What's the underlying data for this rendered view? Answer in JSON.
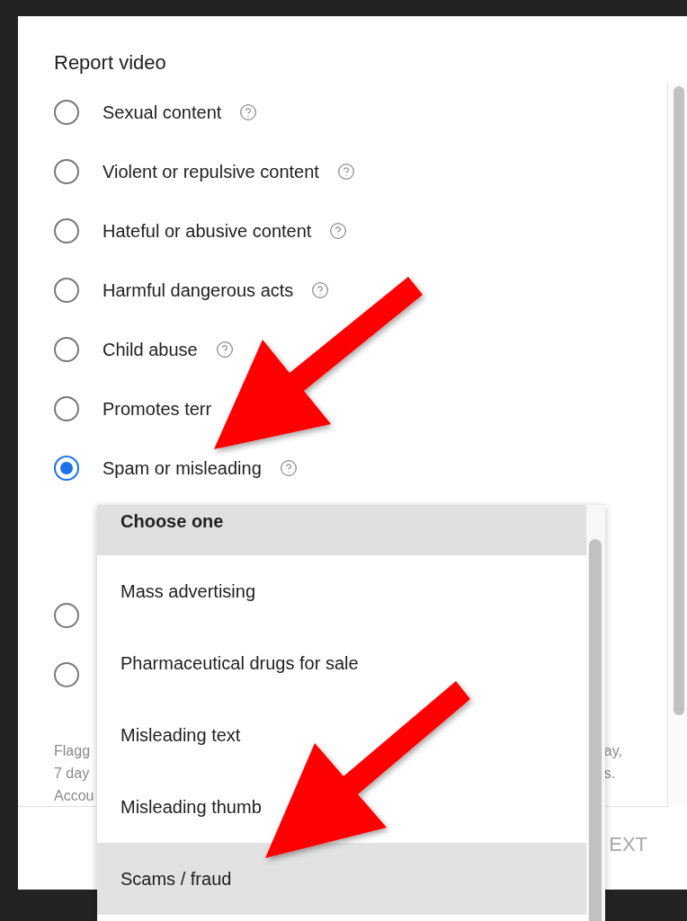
{
  "dialog": {
    "title": "Report video"
  },
  "options": [
    {
      "label": "Sexual content",
      "selected": false
    },
    {
      "label": "Violent or repulsive content",
      "selected": false
    },
    {
      "label": "Hateful or abusive content",
      "selected": false
    },
    {
      "label": "Harmful dangerous acts",
      "selected": false
    },
    {
      "label": "Child abuse",
      "selected": false
    },
    {
      "label": "Promotes terr",
      "selected": false,
      "help_hidden": true
    },
    {
      "label": "Spam or misleading",
      "selected": true
    },
    {
      "selected": false
    },
    {
      "selected": false
    }
  ],
  "dropdown": {
    "header": "Choose one",
    "items": [
      {
        "label": "Mass advertising",
        "selected": false
      },
      {
        "label": "Pharmaceutical drugs for sale",
        "selected": false
      },
      {
        "label": "Misleading text",
        "selected": false
      },
      {
        "label": "Misleading thumb",
        "selected": false
      },
      {
        "label": "Scams / fraud",
        "selected": true
      }
    ]
  },
  "footer_note": {
    "left_lines": [
      "Flagg",
      "7 day",
      "Accou"
    ],
    "right_lines": [
      "ay,",
      "s."
    ]
  },
  "next_button": "EXT",
  "annotations": [
    {
      "kind": "arrow"
    },
    {
      "kind": "arrow"
    }
  ]
}
